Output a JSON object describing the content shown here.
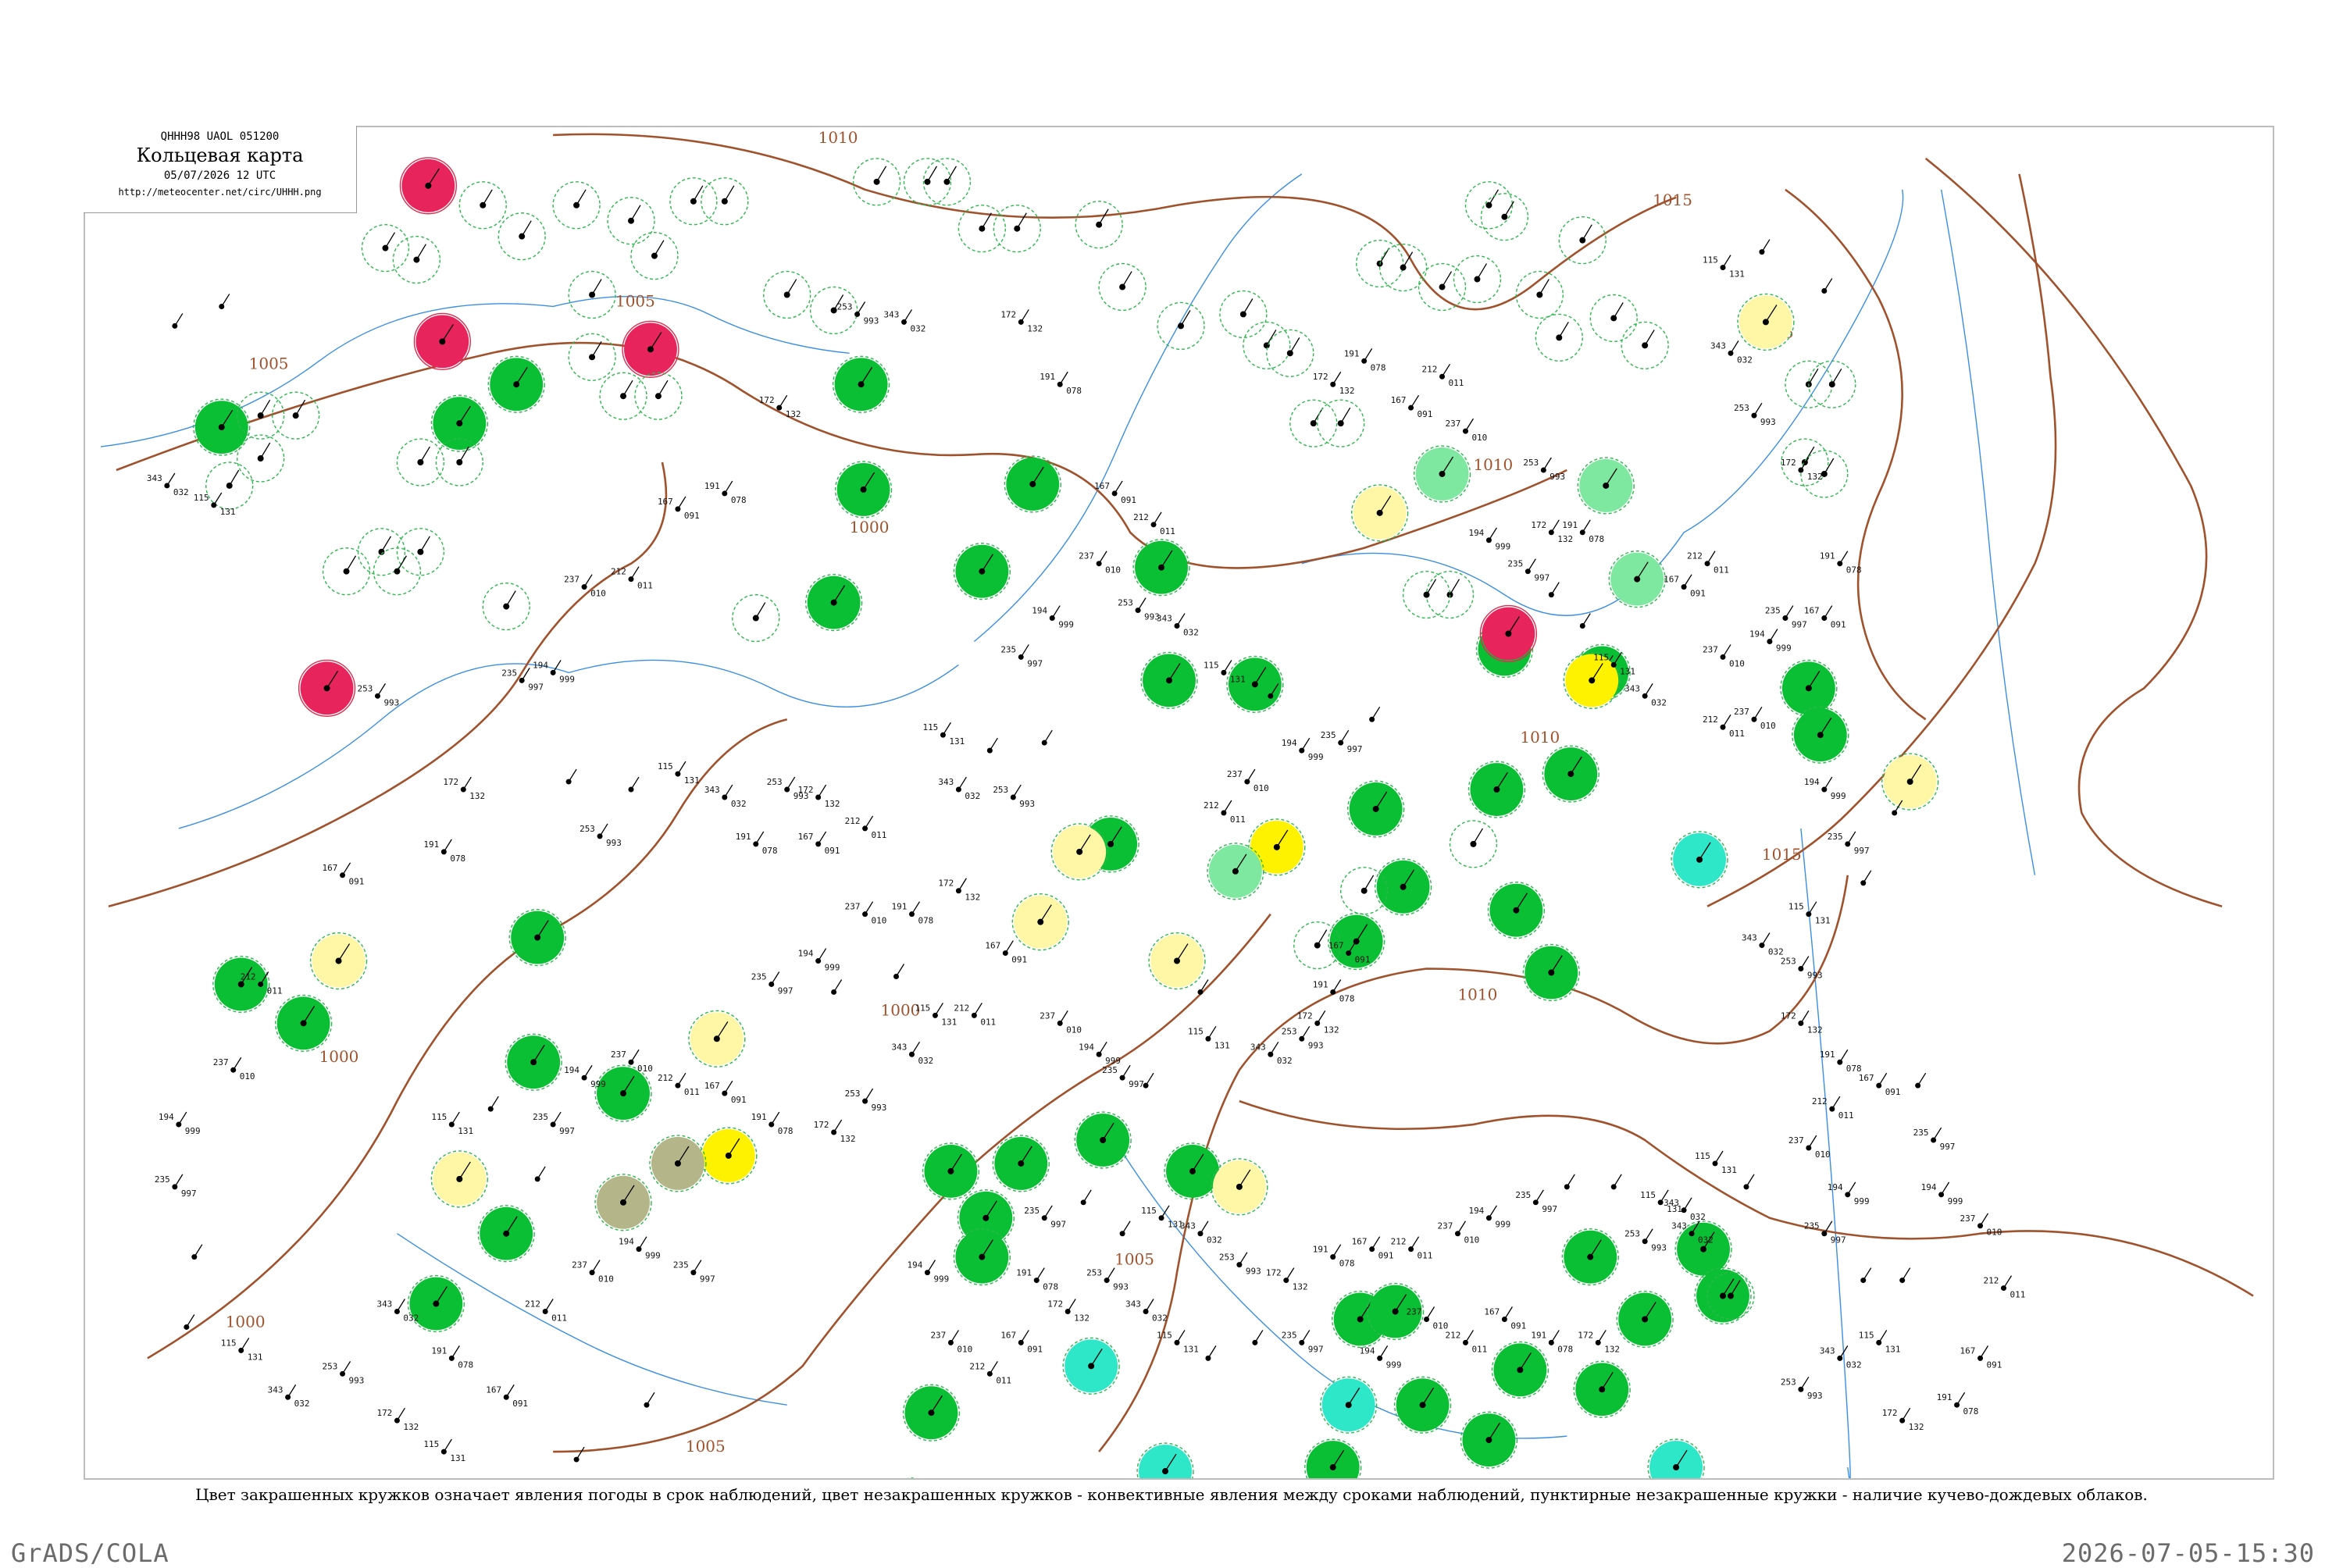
{
  "header": {
    "code": "QHHH98  UAOL  051200",
    "title": "Кольцевая карта",
    "date": "05/07/2026 12 UTC",
    "url": "http://meteocenter.net/circ/UHHH.png"
  },
  "caption": "Цвет закрашенных кружков означает явления погоды в срок наблюдений, цвет незакрашенных кружков - конвективные явления между сроками наблюдений, пунктирные незакрашенные кружки - наличие кучево-дождевых облаков.",
  "footer": {
    "left": "GrADS/COLA",
    "right": "2026-07-05-15:30"
  },
  "colors": {
    "green": "#0bbf35",
    "red": "#e8245c",
    "yellow": "#fff200",
    "light_yellow": "#fff6a6",
    "olive": "#b5b58a",
    "cyan": "#2ee6c8",
    "light_green": "#7ee8a0",
    "isobar": "#a0522d",
    "river": "#3a8ee6"
  },
  "isobars": [
    "1010",
    "1015",
    "1005",
    "1000",
    "1000",
    "1010",
    "1010",
    "1015",
    "1015",
    "1000",
    "1005",
    "1000",
    "1005",
    "1005",
    "1010",
    "1015"
  ],
  "stations": [
    {
      "color": "green",
      "a": "",
      "b": ""
    },
    {
      "color": "red",
      "a": "",
      "b": ""
    },
    {
      "color": "yellow",
      "a": "115",
      "b": "131"
    },
    {
      "color": "light_yellow",
      "a": "343",
      "b": "032"
    },
    {
      "color": "olive",
      "a": "253",
      "b": "993"
    },
    {
      "color": "cyan",
      "a": "172",
      "b": "132"
    },
    {
      "color": "light_green",
      "a": "191",
      "b": "078"
    },
    {
      "color": "ring",
      "a": "167",
      "b": "091"
    },
    {
      "color": "plain",
      "a": "212",
      "b": "011"
    },
    {
      "color": "plain",
      "a": "237",
      "b": "010"
    },
    {
      "color": "plain",
      "a": "194",
      "b": "999"
    },
    {
      "color": "plain",
      "a": "235",
      "b": "997"
    }
  ]
}
